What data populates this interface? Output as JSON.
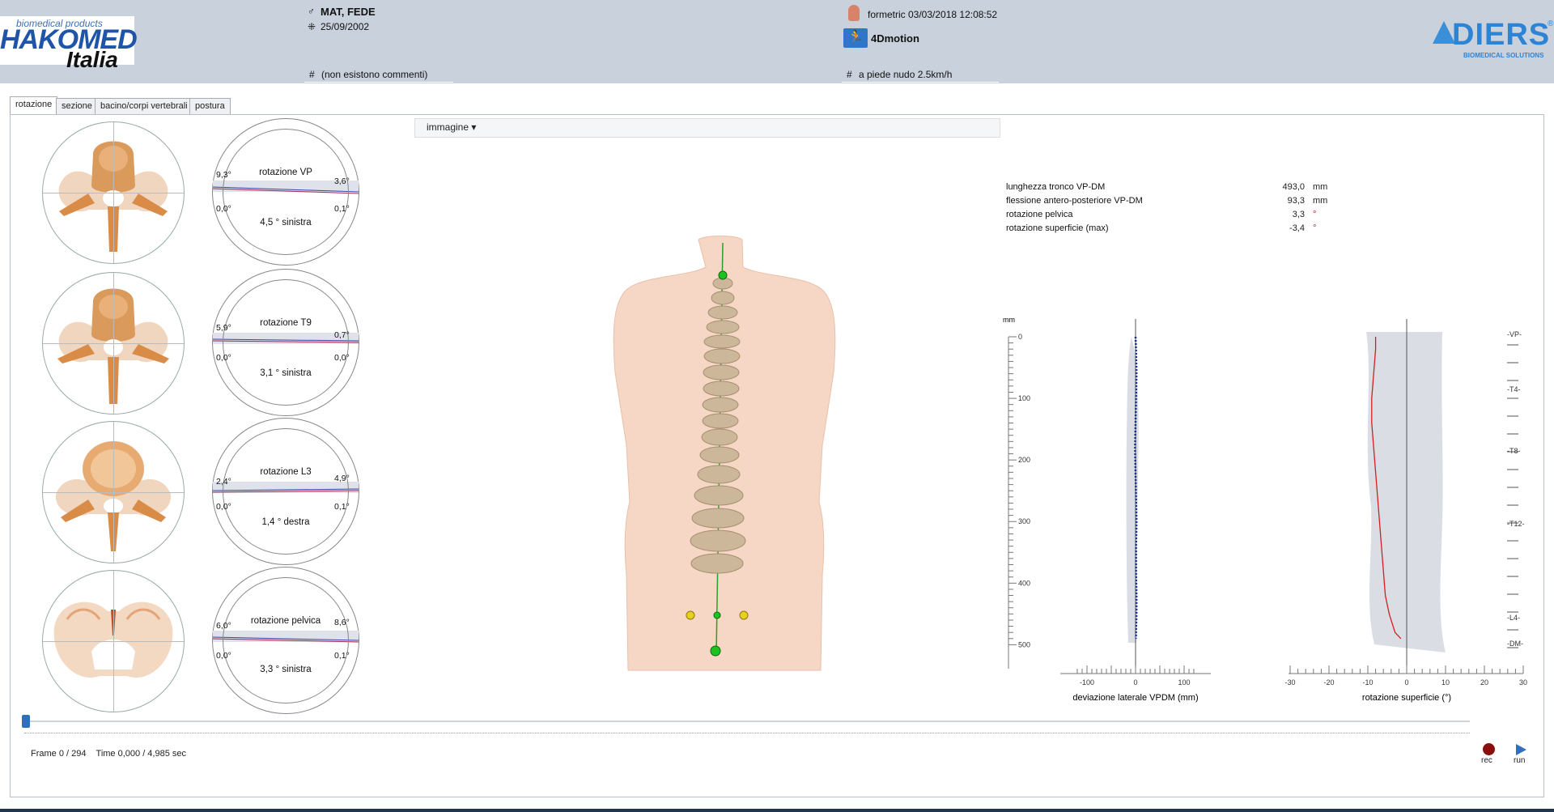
{
  "header": {
    "logo_left": {
      "sub": "biomedical products",
      "main": "HAKOMED",
      "italia": "Italia"
    },
    "patient_name": "MAT, FEDE",
    "patient_sex_icon": "♂",
    "birth_icon": "⁜",
    "birth_date": "25/09/2002",
    "comment_icon": "#",
    "comment": "(non esistono commenti)",
    "scan_icon": "person-icon",
    "scan_info": "formetric 03/03/2018 12:08:52",
    "mode": "4Dmotion",
    "condition_icon": "#",
    "condition": "a piede nudo 2.5km/h",
    "logo_right": {
      "word": "DIERS",
      "reg": "®",
      "sub": "BIOMEDICAL SOLUTIONS"
    }
  },
  "tabs": [
    {
      "label": "rotazione",
      "active": true
    },
    {
      "label": "sezione",
      "active": false
    },
    {
      "label": "bacino/corpi vertebrali",
      "active": false
    },
    {
      "label": "postura",
      "active": false
    }
  ],
  "rotation_gauges": [
    {
      "label": "rotazione VP",
      "left_top": "9,3°",
      "right_top": "3,6°",
      "left_bottom": "0,0°",
      "right_bottom": "0,1°",
      "result": "4,5 ° sinistra"
    },
    {
      "label": "rotazione T9",
      "left_top": "5,9°",
      "right_top": "0,7°",
      "left_bottom": "0,0°",
      "right_bottom": "0,0°",
      "result": "3,1 ° sinistra"
    },
    {
      "label": "rotazione L3",
      "left_top": "2,4°",
      "right_top": "4,9°",
      "left_bottom": "0,0°",
      "right_bottom": "0,1°",
      "result": "1,4 ° destra"
    },
    {
      "label": "rotazione pelvica",
      "left_top": "6,0°",
      "right_top": "8,6°",
      "left_bottom": "0,0°",
      "right_bottom": "0,1°",
      "result": "3,3 ° sinistra"
    }
  ],
  "view_toolbar": {
    "button": "immagine ▾"
  },
  "measurements": [
    {
      "label": "lunghezza tronco VP-DM",
      "value": "493,0",
      "unit": "mm"
    },
    {
      "label": "flessione antero-posteriore VP-DM",
      "value": "93,3",
      "unit": "mm"
    },
    {
      "label": "rotazione pelvica",
      "value": "3,3",
      "unit": "°"
    },
    {
      "label": "rotazione superficie (max)",
      "value": "-3,4",
      "unit": "°"
    }
  ],
  "chart_lateral": {
    "y_unit": "mm",
    "y_ticks": [
      "0",
      "100",
      "200",
      "300",
      "400",
      "500"
    ],
    "x_ticks": [
      "-100",
      "0",
      "100"
    ],
    "xlabel": "deviazione laterale VPDM (mm)"
  },
  "chart_rotation": {
    "x_ticks": [
      "-30",
      "-20",
      "-10",
      "0",
      "10",
      "20",
      "30"
    ],
    "xlabel": "rotazione superficie (°)",
    "right_labels": [
      "-VP-",
      "-T4-",
      "-T8-",
      "-T12-",
      "-L4-",
      "-DM-"
    ]
  },
  "chart_data": [
    {
      "type": "line",
      "title": "",
      "xlabel": "deviazione laterale VPDM (mm)",
      "ylabel": "mm",
      "xlim": [
        -110,
        110
      ],
      "ylim": [
        0,
        510
      ],
      "x": [
        0,
        1,
        2,
        1,
        0,
        -1,
        0,
        1,
        2,
        1,
        1,
        2,
        2,
        1,
        1
      ],
      "y": [
        0,
        20,
        60,
        100,
        140,
        180,
        220,
        260,
        300,
        340,
        380,
        420,
        450,
        480,
        490
      ]
    },
    {
      "type": "line",
      "title": "",
      "xlabel": "rotazione superficie (°)",
      "ylabel": "",
      "xlim": [
        -30,
        30
      ],
      "ylim": [
        0,
        510
      ],
      "x": [
        -8,
        -8,
        -8.5,
        -9,
        -9,
        -8.5,
        -8,
        -7.5,
        -7,
        -6.5,
        -6,
        -5.5,
        -4.5,
        -3,
        -1.5
      ],
      "y": [
        0,
        20,
        60,
        100,
        140,
        180,
        220,
        260,
        300,
        340,
        380,
        420,
        450,
        480,
        490
      ]
    }
  ],
  "timeline": {
    "frame_text": "Frame 0 / 294",
    "time_text": "Time 0,000 / 4,985 sec",
    "rec_label": "rec",
    "run_label": "run"
  },
  "colors": {
    "header_bg": "#c9d1dc",
    "accent": "#2f6fbf",
    "rec": "#8b0e0e",
    "skin": "#f6d6c4",
    "bone": "#d99a5c"
  }
}
